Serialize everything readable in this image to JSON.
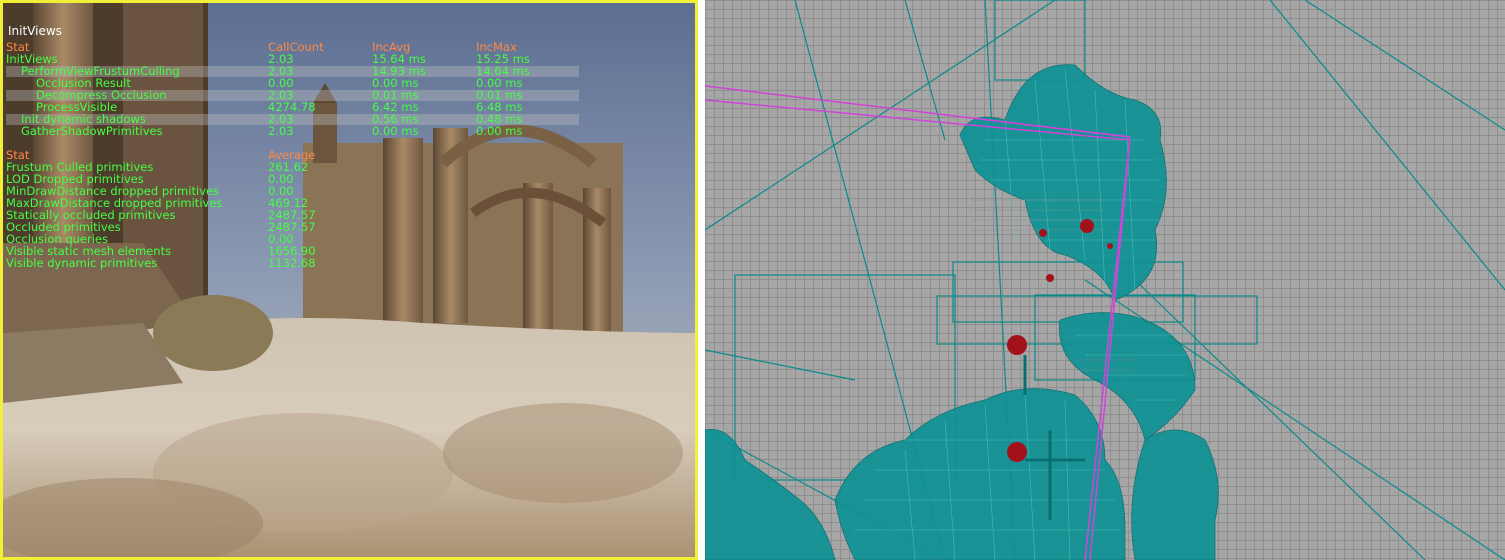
{
  "window_title": "InitViews",
  "timing_stats": {
    "headers": [
      "Stat",
      "CallCount",
      "IncAvg",
      "IncMax"
    ],
    "rows": [
      {
        "name": "InitViews",
        "callcount": "2.03",
        "incavg": "15.64 ms",
        "incmax": "15.25 ms",
        "highlight": false
      },
      {
        "name": "PerformViewFrustumCulling",
        "callcount": "2.03",
        "incavg": "14.93 ms",
        "incmax": "14.64 ms",
        "highlight": true
      },
      {
        "name": "Occlusion Result",
        "callcount": "0.00",
        "incavg": "0.00 ms",
        "incmax": "0.00 ms",
        "highlight": false
      },
      {
        "name": "Decompress Occlusion",
        "callcount": "2.03",
        "incavg": "0.01 ms",
        "incmax": "0.01 ms",
        "highlight": true
      },
      {
        "name": "ProcessVisible",
        "callcount": "4274.78",
        "incavg": "6.42 ms",
        "incmax": "6.48 ms",
        "highlight": false
      },
      {
        "name": "Init dynamic shadows",
        "callcount": "2.03",
        "incavg": "0.56 ms",
        "incmax": "0.48 ms",
        "highlight": true
      },
      {
        "name": "GatherShadowPrimitives",
        "callcount": "2.03",
        "incavg": "0.00 ms",
        "incmax": "0.00 ms",
        "highlight": false
      }
    ]
  },
  "counter_stats": {
    "headers": [
      "Stat",
      "Average"
    ],
    "rows": [
      {
        "name": "Frustum Culled primitives",
        "value": "261.62"
      },
      {
        "name": "LOD Dropped primitives",
        "value": "0.00"
      },
      {
        "name": "MinDrawDistance dropped primitives",
        "value": "0.00"
      },
      {
        "name": "MaxDrawDistance dropped primitives",
        "value": "469.12"
      },
      {
        "name": "Statically occluded primitives",
        "value": "2487.57"
      },
      {
        "name": "Occluded primitives",
        "value": "2487.57"
      },
      {
        "name": "Occlusion queries",
        "value": "0.00"
      },
      {
        "name": "Visible static mesh elements",
        "value": "1656.90"
      },
      {
        "name": "Visible dynamic primitives",
        "value": "1132.68"
      }
    ]
  },
  "colors": {
    "viewport_border": "#f2ef39",
    "header_text": "#ff8844",
    "stat_text": "#44ff44",
    "wireframe": "#008b8b",
    "frustum_lines": "#d04ad8",
    "grid_bg": "#a6a6a6"
  }
}
